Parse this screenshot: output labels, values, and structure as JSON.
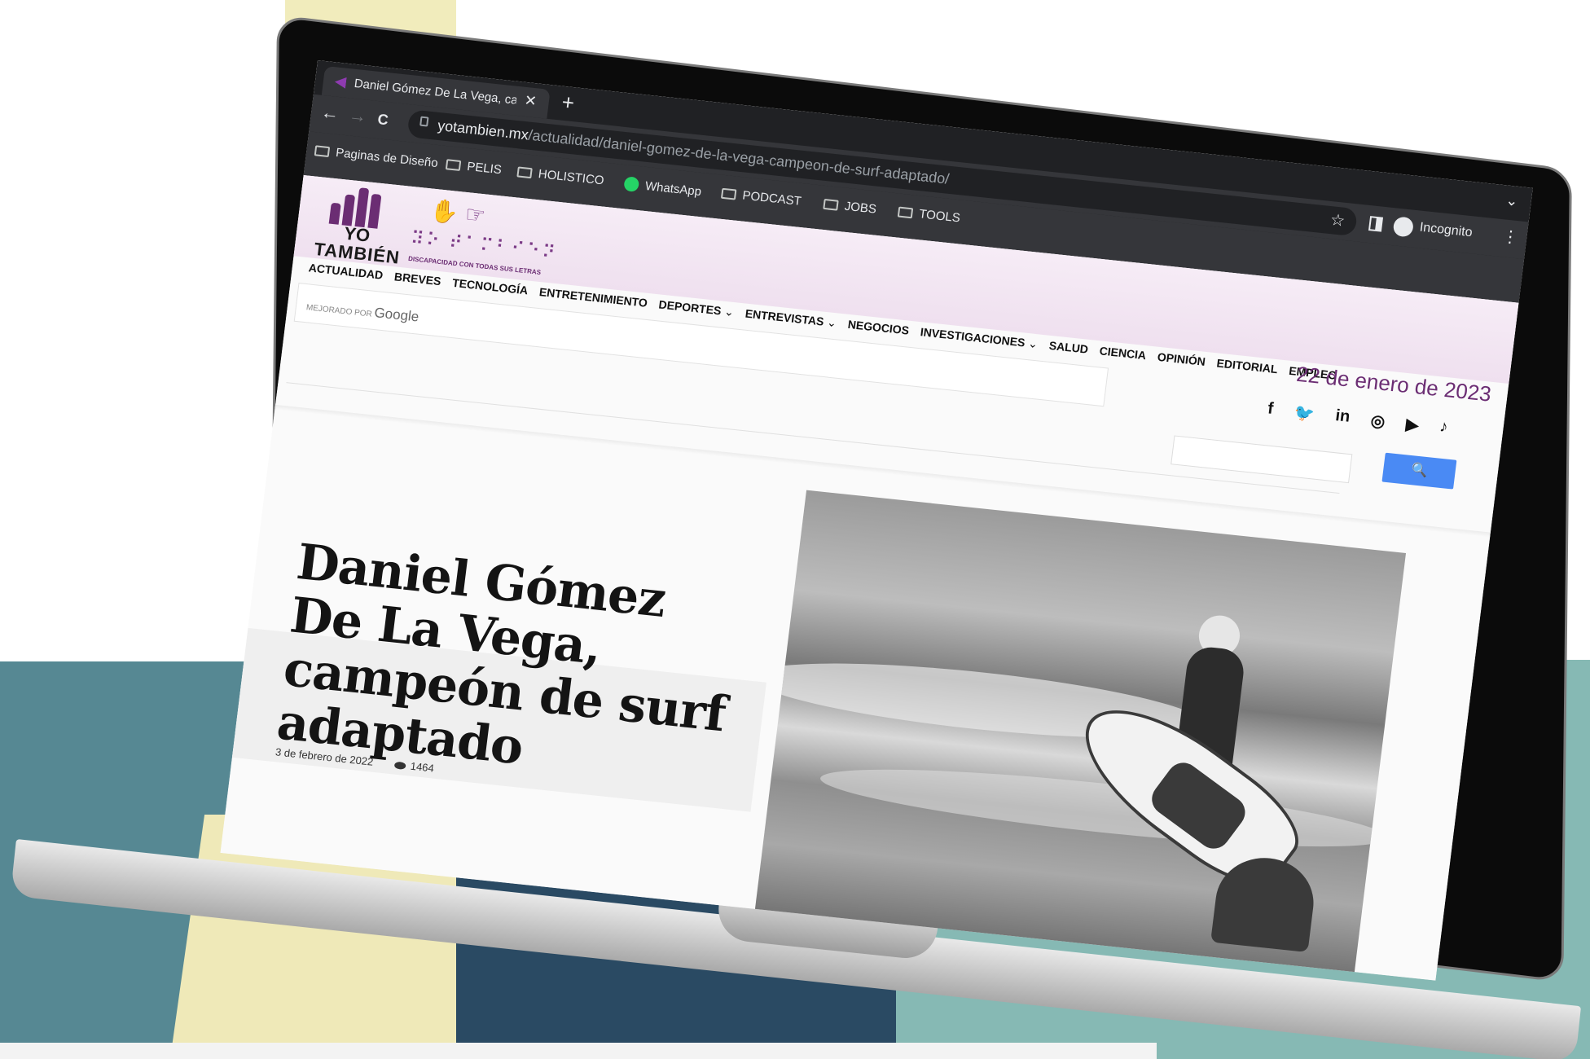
{
  "browser": {
    "tab_title": "Daniel Gómez De La Vega, cam",
    "tab_close": "✕",
    "new_tab": "+",
    "tab_list": "⌄",
    "back": "←",
    "forward": "→",
    "reload": "C",
    "url_host": "yotambien.mx",
    "url_path": "/actualidad/daniel-gomez-de-la-vega-campeon-de-surf-adaptado/",
    "star": "☆",
    "incognito_label": "Incognito",
    "menu": "⋮",
    "bookmarks": [
      "Paginas de Diseño",
      "PELIS",
      "HOLISTICO",
      "WhatsApp",
      "PODCAST",
      "JOBS",
      "TOOLS"
    ]
  },
  "site": {
    "logo_yo": "YO",
    "logo_tambien": "TAMBIÉN",
    "braille": "⠽⠕ ⠞⠁⠍⠃⠊⠑⠝",
    "hands": "✋ ☞",
    "tagline": "DISCAPACIDAD CON TODAS SUS LETRAS",
    "menu": [
      {
        "label": "ACTUALIDAD",
        "chev": ""
      },
      {
        "label": "BREVES",
        "chev": ""
      },
      {
        "label": "TECNOLOGÍA",
        "chev": ""
      },
      {
        "label": "ENTRETENIMIENTO",
        "chev": ""
      },
      {
        "label": "DEPORTES",
        "chev": "⌄"
      },
      {
        "label": "ENTREVISTAS",
        "chev": "⌄"
      },
      {
        "label": "NEGOCIOS",
        "chev": ""
      },
      {
        "label": "INVESTIGACIONES",
        "chev": "⌄"
      },
      {
        "label": "SALUD",
        "chev": ""
      },
      {
        "label": "CIENCIA",
        "chev": ""
      },
      {
        "label": "OPINIÓN",
        "chev": ""
      },
      {
        "label": "EDITORIAL",
        "chev": ""
      },
      {
        "label": "EMPLEO",
        "chev": ""
      }
    ],
    "date": "22 de enero de 2023",
    "search_brand_prefix": "MEJORADO POR",
    "search_brand": "Google",
    "search_button": "🔍",
    "social": [
      "f",
      "🐦",
      "in",
      "◎",
      "▶",
      "♪"
    ]
  },
  "article": {
    "title": "Daniel Gómez De La Vega, campeón de surf adaptado",
    "date": "3 de febrero de 2022",
    "views": "1464"
  },
  "colors": {
    "brand_purple": "#6b2d73",
    "chrome_dark": "#202124",
    "search_blue": "#4a8af4"
  }
}
